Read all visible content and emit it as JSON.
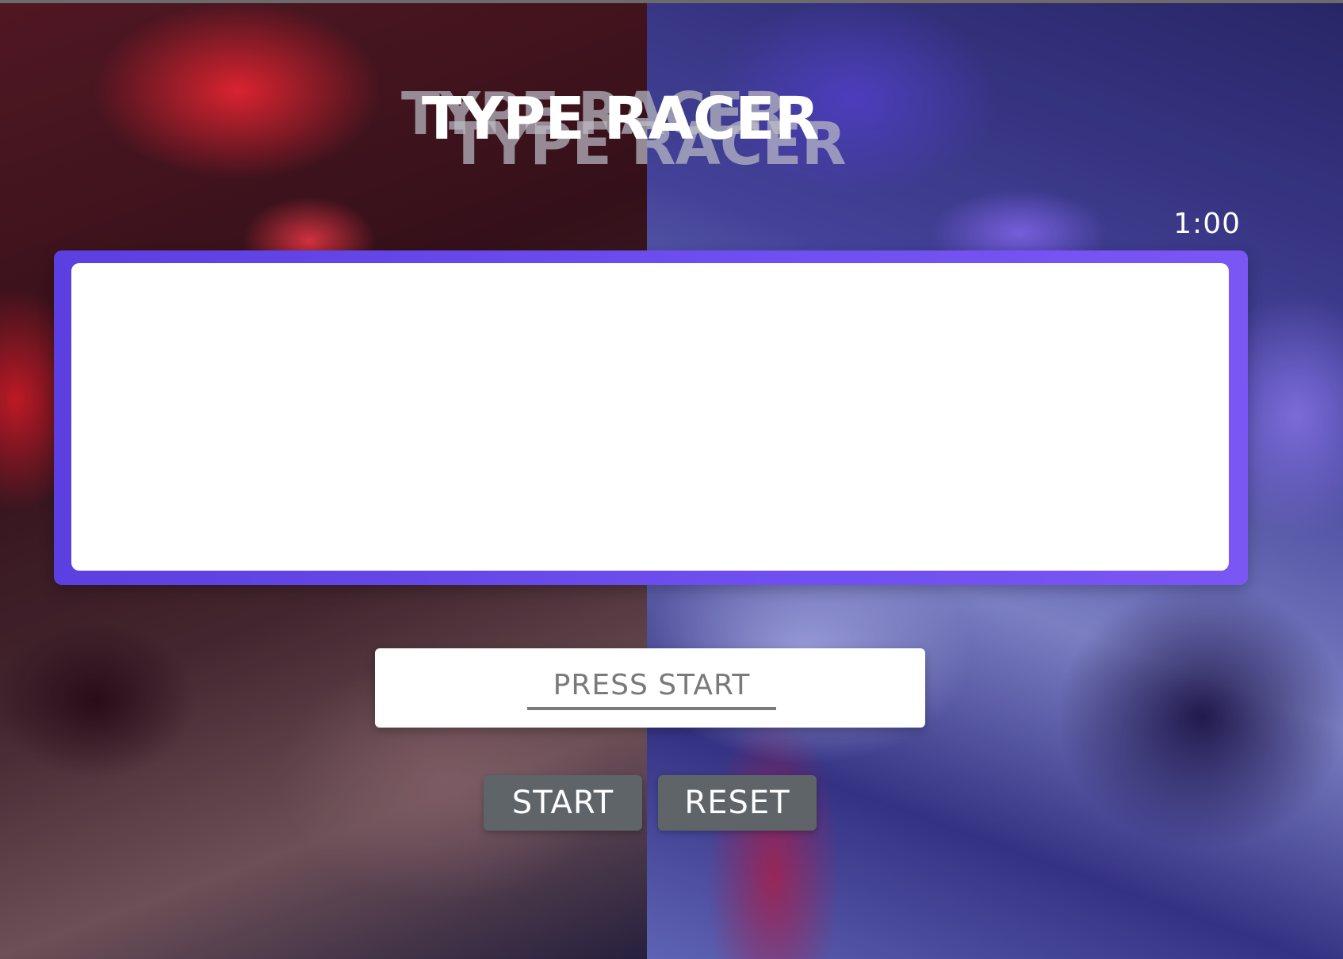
{
  "app": {
    "title": "TYPE RACER"
  },
  "timer": {
    "value": "1:00"
  },
  "text_display": {
    "content": ""
  },
  "typing_input": {
    "placeholder": "PRESS START",
    "value": ""
  },
  "controls": {
    "start_label": "START",
    "reset_label": "RESET"
  },
  "colors": {
    "frame_accent": "#6f4ff0",
    "button_bg": "#5e6468",
    "background_left_tint": "#e0202c",
    "background_right_tint": "#5a4adc"
  }
}
